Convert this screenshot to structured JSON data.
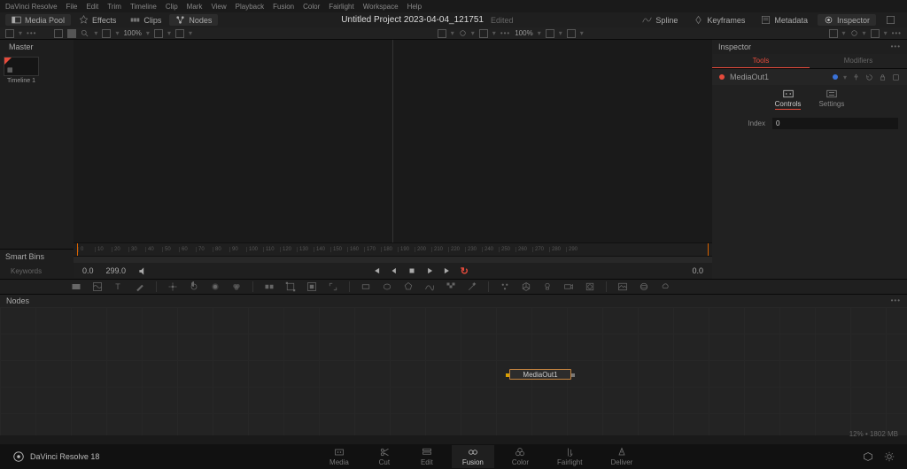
{
  "menubar": [
    "DaVinci Resolve",
    "File",
    "Edit",
    "Trim",
    "Timeline",
    "Clip",
    "Mark",
    "View",
    "Playback",
    "Fusion",
    "Color",
    "Fairlight",
    "Workspace",
    "Help"
  ],
  "titlebar": {
    "left": {
      "mediaPool": "Media Pool",
      "effects": "Effects",
      "clips": "Clips",
      "nodes": "Nodes"
    },
    "title": "Untitled Project 2023-04-04_121751",
    "edited": "Edited",
    "right": {
      "spline": "Spline",
      "keyframes": "Keyframes",
      "metadata": "Metadata",
      "inspector": "Inspector"
    }
  },
  "toolbar": {
    "zoom": "100%"
  },
  "mediaPanel": {
    "master": "Master",
    "timeline1": "Timeline 1",
    "smartBins": "Smart Bins",
    "keywords": "Keywords"
  },
  "ruler": [
    "0",
    "10",
    "20",
    "30",
    "40",
    "50",
    "60",
    "70",
    "80",
    "90",
    "100",
    "110",
    "120",
    "130",
    "140",
    "150",
    "160",
    "170",
    "180",
    "190",
    "200",
    "210",
    "220",
    "230",
    "240",
    "250",
    "260",
    "270",
    "280",
    "290"
  ],
  "transport": {
    "cur": "0.0",
    "end": "299.0",
    "right": "0.0"
  },
  "inspector": {
    "title": "Inspector",
    "tools": "Tools",
    "modifiers": "Modifiers",
    "nodeName": "MediaOut1",
    "controls": "Controls",
    "settings": "Settings",
    "indexLabel": "Index",
    "indexValue": "0"
  },
  "nodesPanel": {
    "title": "Nodes",
    "nodeLabel": "MediaOut1"
  },
  "status": "12% • 1802 MB",
  "footer": {
    "brand": "DaVinci Resolve 18",
    "pages": [
      "Media",
      "Cut",
      "Edit",
      "Fusion",
      "Color",
      "Fairlight",
      "Deliver"
    ],
    "active": "Fusion"
  }
}
